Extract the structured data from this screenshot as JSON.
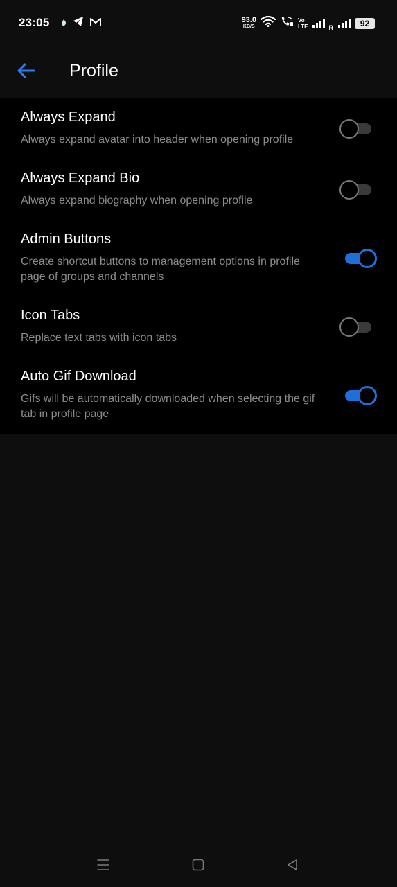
{
  "status_bar": {
    "time": "23:05",
    "net_speed_value": "93.0",
    "net_speed_unit": "KB/S",
    "volte_top": "Vo",
    "volte_bottom": "LTE",
    "roaming_label": "R",
    "battery": "92",
    "icons": [
      "sticky-dot-icon",
      "telegram-icon",
      "gmail-icon",
      "wifi-icon",
      "wifi-call-icon",
      "signal-icon",
      "signal-icon"
    ]
  },
  "app_bar": {
    "title": "Profile",
    "back_icon": "arrow-left-icon"
  },
  "settings": [
    {
      "title": "Always Expand",
      "description": "Always expand avatar into header when opening profile",
      "enabled": false
    },
    {
      "title": "Always Expand Bio",
      "description": "Always expand biography when opening profile",
      "enabled": false
    },
    {
      "title": "Admin Buttons",
      "description": "Create shortcut buttons to management options in profile page of groups and channels",
      "enabled": true
    },
    {
      "title": "Icon Tabs",
      "description": "Replace text tabs with icon tabs",
      "enabled": false
    },
    {
      "title": "Auto Gif Download",
      "description": "Gifs will be automatically downloaded when selecting the gif tab in profile page",
      "enabled": true
    }
  ],
  "nav_bar": {
    "icons": [
      "menu-icon",
      "home-square-icon",
      "back-triangle-icon"
    ]
  },
  "colors": {
    "accent": "#1e6fdb",
    "background": "#0e0e0e",
    "list_background": "#000000",
    "secondary_text": "#8c8c8c"
  }
}
